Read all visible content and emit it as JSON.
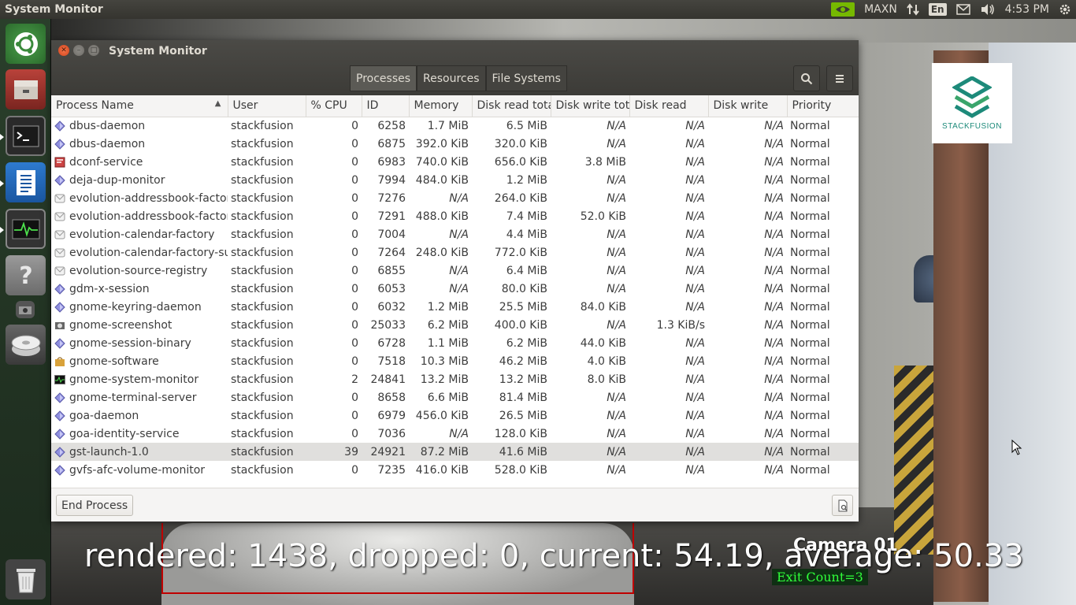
{
  "top_panel": {
    "title": "System Monitor",
    "power_mode": "MAXN",
    "keyboard_layout": "En",
    "clock": "4:53 PM"
  },
  "window": {
    "title": "System Monitor",
    "tabs": [
      {
        "label": "Processes",
        "active": true
      },
      {
        "label": "Resources",
        "active": false
      },
      {
        "label": "File Systems",
        "active": false
      }
    ],
    "columns": [
      "Process Name",
      "User",
      "% CPU",
      "ID",
      "Memory",
      "Disk read tota",
      "Disk write tota",
      "Disk read",
      "Disk write",
      "Priority"
    ],
    "rows": [
      {
        "name": "dbus-daemon",
        "icon": "generic-process-icon",
        "user": "stackfusion",
        "cpu": "0",
        "id": "6258",
        "memory": "1.7 MiB",
        "disk_read_total": "6.5 MiB",
        "disk_write_total": "N/A",
        "disk_read": "N/A",
        "disk_write": "N/A",
        "priority": "Normal"
      },
      {
        "name": "dbus-daemon",
        "icon": "generic-process-icon",
        "user": "stackfusion",
        "cpu": "0",
        "id": "6875",
        "memory": "392.0 KiB",
        "disk_read_total": "320.0 KiB",
        "disk_write_total": "N/A",
        "disk_read": "N/A",
        "disk_write": "N/A",
        "priority": "Normal"
      },
      {
        "name": "dconf-service",
        "icon": "dconf-icon",
        "user": "stackfusion",
        "cpu": "0",
        "id": "6983",
        "memory": "740.0 KiB",
        "disk_read_total": "656.0 KiB",
        "disk_write_total": "3.8 MiB",
        "disk_read": "N/A",
        "disk_write": "N/A",
        "priority": "Normal"
      },
      {
        "name": "deja-dup-monitor",
        "icon": "generic-process-icon",
        "user": "stackfusion",
        "cpu": "0",
        "id": "7994",
        "memory": "484.0 KiB",
        "disk_read_total": "1.2 MiB",
        "disk_write_total": "N/A",
        "disk_read": "N/A",
        "disk_write": "N/A",
        "priority": "Normal"
      },
      {
        "name": "evolution-addressbook-factory",
        "icon": "evolution-icon",
        "user": "stackfusion",
        "cpu": "0",
        "id": "7276",
        "memory": "N/A",
        "disk_read_total": "264.0 KiB",
        "disk_write_total": "N/A",
        "disk_read": "N/A",
        "disk_write": "N/A",
        "priority": "Normal"
      },
      {
        "name": "evolution-addressbook-factory",
        "icon": "evolution-icon",
        "user": "stackfusion",
        "cpu": "0",
        "id": "7291",
        "memory": "488.0 KiB",
        "disk_read_total": "7.4 MiB",
        "disk_write_total": "52.0 KiB",
        "disk_read": "N/A",
        "disk_write": "N/A",
        "priority": "Normal"
      },
      {
        "name": "evolution-calendar-factory",
        "icon": "evolution-icon",
        "user": "stackfusion",
        "cpu": "0",
        "id": "7004",
        "memory": "N/A",
        "disk_read_total": "4.4 MiB",
        "disk_write_total": "N/A",
        "disk_read": "N/A",
        "disk_write": "N/A",
        "priority": "Normal"
      },
      {
        "name": "evolution-calendar-factory-sub",
        "icon": "evolution-icon",
        "user": "stackfusion",
        "cpu": "0",
        "id": "7264",
        "memory": "248.0 KiB",
        "disk_read_total": "772.0 KiB",
        "disk_write_total": "N/A",
        "disk_read": "N/A",
        "disk_write": "N/A",
        "priority": "Normal"
      },
      {
        "name": "evolution-source-registry",
        "icon": "evolution-icon",
        "user": "stackfusion",
        "cpu": "0",
        "id": "6855",
        "memory": "N/A",
        "disk_read_total": "6.4 MiB",
        "disk_write_total": "N/A",
        "disk_read": "N/A",
        "disk_write": "N/A",
        "priority": "Normal"
      },
      {
        "name": "gdm-x-session",
        "icon": "generic-process-icon",
        "user": "stackfusion",
        "cpu": "0",
        "id": "6053",
        "memory": "N/A",
        "disk_read_total": "80.0 KiB",
        "disk_write_total": "N/A",
        "disk_read": "N/A",
        "disk_write": "N/A",
        "priority": "Normal"
      },
      {
        "name": "gnome-keyring-daemon",
        "icon": "generic-process-icon",
        "user": "stackfusion",
        "cpu": "0",
        "id": "6032",
        "memory": "1.2 MiB",
        "disk_read_total": "25.5 MiB",
        "disk_write_total": "84.0 KiB",
        "disk_read": "N/A",
        "disk_write": "N/A",
        "priority": "Normal"
      },
      {
        "name": "gnome-screenshot",
        "icon": "screenshot-icon",
        "user": "stackfusion",
        "cpu": "0",
        "id": "25033",
        "memory": "6.2 MiB",
        "disk_read_total": "400.0 KiB",
        "disk_write_total": "N/A",
        "disk_read": "1.3 KiB/s",
        "disk_write": "N/A",
        "priority": "Normal"
      },
      {
        "name": "gnome-session-binary",
        "icon": "generic-process-icon",
        "user": "stackfusion",
        "cpu": "0",
        "id": "6728",
        "memory": "1.1 MiB",
        "disk_read_total": "6.2 MiB",
        "disk_write_total": "44.0 KiB",
        "disk_read": "N/A",
        "disk_write": "N/A",
        "priority": "Normal"
      },
      {
        "name": "gnome-software",
        "icon": "software-icon",
        "user": "stackfusion",
        "cpu": "0",
        "id": "7518",
        "memory": "10.3 MiB",
        "disk_read_total": "46.2 MiB",
        "disk_write_total": "4.0 KiB",
        "disk_read": "N/A",
        "disk_write": "N/A",
        "priority": "Normal"
      },
      {
        "name": "gnome-system-monitor",
        "icon": "system-monitor-icon",
        "user": "stackfusion",
        "cpu": "2",
        "id": "24841",
        "memory": "13.2 MiB",
        "disk_read_total": "13.2 MiB",
        "disk_write_total": "8.0 KiB",
        "disk_read": "N/A",
        "disk_write": "N/A",
        "priority": "Normal"
      },
      {
        "name": "gnome-terminal-server",
        "icon": "generic-process-icon",
        "user": "stackfusion",
        "cpu": "0",
        "id": "8658",
        "memory": "6.6 MiB",
        "disk_read_total": "81.4 MiB",
        "disk_write_total": "N/A",
        "disk_read": "N/A",
        "disk_write": "N/A",
        "priority": "Normal"
      },
      {
        "name": "goa-daemon",
        "icon": "generic-process-icon",
        "user": "stackfusion",
        "cpu": "0",
        "id": "6979",
        "memory": "456.0 KiB",
        "disk_read_total": "26.5 MiB",
        "disk_write_total": "N/A",
        "disk_read": "N/A",
        "disk_write": "N/A",
        "priority": "Normal"
      },
      {
        "name": "goa-identity-service",
        "icon": "generic-process-icon",
        "user": "stackfusion",
        "cpu": "0",
        "id": "7036",
        "memory": "N/A",
        "disk_read_total": "128.0 KiB",
        "disk_write_total": "N/A",
        "disk_read": "N/A",
        "disk_write": "N/A",
        "priority": "Normal"
      },
      {
        "name": "gst-launch-1.0",
        "icon": "generic-process-icon",
        "user": "stackfusion",
        "cpu": "39",
        "id": "24921",
        "memory": "87.2 MiB",
        "disk_read_total": "41.6 MiB",
        "disk_write_total": "N/A",
        "disk_read": "N/A",
        "disk_write": "N/A",
        "priority": "Normal",
        "selected": true
      },
      {
        "name": "gvfs-afc-volume-monitor",
        "icon": "generic-process-icon",
        "user": "stackfusion",
        "cpu": "0",
        "id": "7235",
        "memory": "416.0 KiB",
        "disk_read_total": "528.0 KiB",
        "disk_write_total": "N/A",
        "disk_read": "N/A",
        "disk_write": "N/A",
        "priority": "Normal"
      }
    ],
    "end_process_label": "End Process"
  },
  "video_overlay": {
    "stats": "rendered: 1438, dropped: 0, current: 54.19, average: 50.33",
    "camera": "Camera 01",
    "exit_count": "Exit Count=3",
    "logo_text": "STACKFUSION"
  },
  "colors": {
    "panel_bg": "#3c3b37",
    "launcher_bg": "#1f2f20",
    "selected_row": "#e0dfdd",
    "exit_count_text": "#2fff3a",
    "close_button": "#e95420"
  }
}
